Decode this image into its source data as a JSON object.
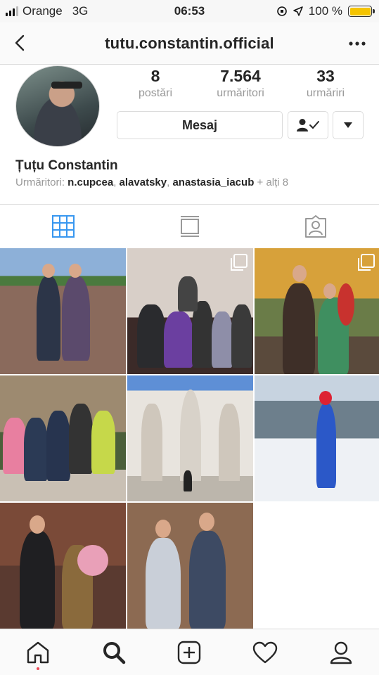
{
  "status_bar": {
    "carrier": "Orange",
    "network": "3G",
    "time": "06:53",
    "battery": "100 %",
    "battery_level": 1.0,
    "battery_color": "#f5c400"
  },
  "nav": {
    "title": "tutu.constantin.official",
    "back_icon": "chevron-left-icon",
    "more_icon": "more-horizontal-icon"
  },
  "profile": {
    "posts_count": "8",
    "posts_label": "postări",
    "followers_count": "7.564",
    "followers_label": "urmăritori",
    "following_count": "33",
    "following_label": "urmăriri",
    "message_button": "Mesaj",
    "name": "Țuțu Constantin",
    "followed_by_label": "Urmăritori:",
    "followed_by": [
      "n.cupcea",
      "alavatsky",
      "anastasia_iacub"
    ],
    "followed_by_more": "+ alți 8"
  },
  "tabs": [
    {
      "icon": "grid-icon",
      "active": true
    },
    {
      "icon": "feed-list-icon",
      "active": false
    },
    {
      "icon": "tagged-person-icon",
      "active": false
    }
  ],
  "bottom_nav": [
    {
      "icon": "home-icon",
      "notification_dot": true
    },
    {
      "icon": "search-icon"
    },
    {
      "icon": "add-post-icon"
    },
    {
      "icon": "heart-icon"
    },
    {
      "icon": "profile-icon"
    }
  ],
  "colors": {
    "accent": "#3897f0",
    "border": "#dbdbdb",
    "secondary_text": "#999999",
    "notification": "#ed4956"
  }
}
